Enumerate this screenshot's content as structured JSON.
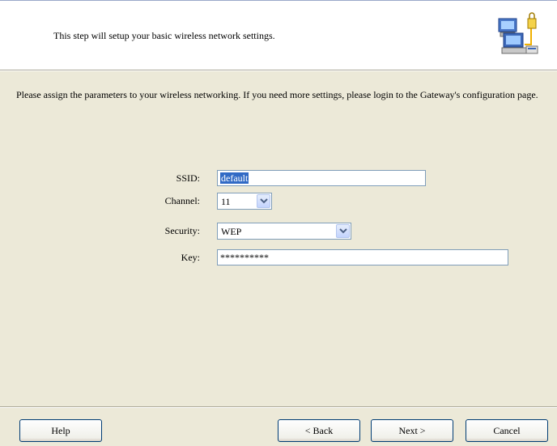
{
  "header": {
    "text": "This step will setup your basic wireless network settings.",
    "icon": "network-computers-icon"
  },
  "intro": {
    "text": "Please assign the parameters to your wireless networking. If you need more settings, please login to the Gateway's configuration page."
  },
  "form": {
    "ssid_label": "SSID:",
    "ssid_value": "default",
    "channel_label": "Channel:",
    "channel_value": "11",
    "security_label": "Security:",
    "security_value": "WEP",
    "key_label": "Key:",
    "key_value": "**********"
  },
  "buttons": {
    "help": "Help",
    "back": "< Back",
    "next": "Next >",
    "cancel": "Cancel"
  },
  "colors": {
    "dialog_bg": "#ece9d8",
    "header_bg": "#ffffff",
    "selection": "#316ac5",
    "input_border": "#7f9db9",
    "button_border": "#003c74"
  }
}
